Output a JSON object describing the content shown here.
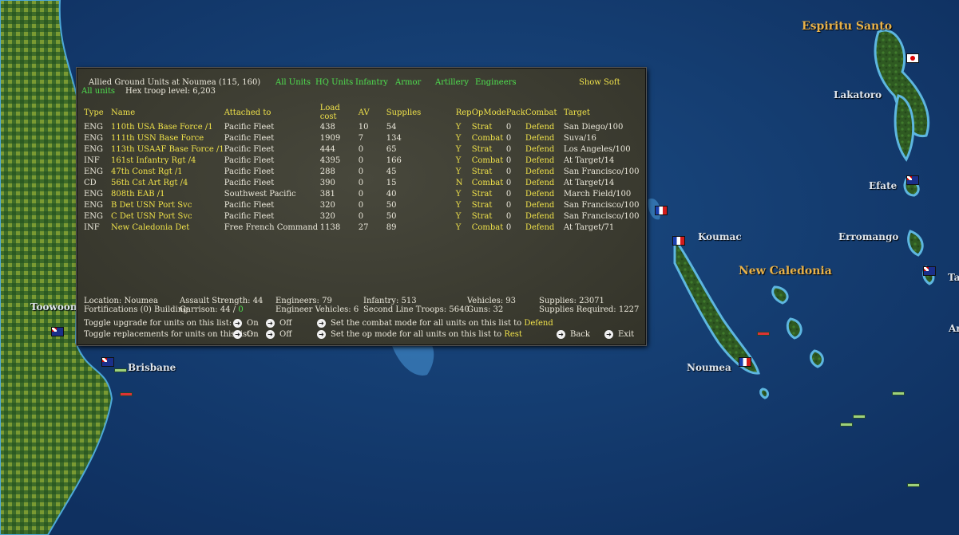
{
  "map": {
    "labels": [
      {
        "id": "espiritu-santo",
        "text": "Espiritu Santo",
        "cls": "region"
      },
      {
        "id": "lakatoro",
        "text": "Lakatoro",
        "cls": ""
      },
      {
        "id": "efate",
        "text": "Efate",
        "cls": ""
      },
      {
        "id": "erromango",
        "text": "Erromango",
        "cls": ""
      },
      {
        "id": "koumac",
        "text": "Koumac",
        "cls": ""
      },
      {
        "id": "new-caledonia",
        "text": "New Caledonia",
        "cls": "region"
      },
      {
        "id": "noumea",
        "text": "Noumea",
        "cls": ""
      },
      {
        "id": "toowoomba",
        "text": "Toowoomb",
        "cls": ""
      },
      {
        "id": "brisbane",
        "text": "Brisbane",
        "cls": ""
      },
      {
        "id": "ta",
        "text": "Ta",
        "cls": ""
      },
      {
        "id": "ar",
        "text": "Ar",
        "cls": ""
      }
    ]
  },
  "panel": {
    "title": "Allied Ground Units at Noumea  (115, 160)",
    "all_units_label": "All units",
    "hex_troop": "Hex troop level: 6,203",
    "filters": [
      "All Units",
      "HQ Units",
      "Infantry",
      "Armor",
      "Artillery",
      "Engineers"
    ],
    "show_soft": "Show Soft",
    "columns": [
      "Type",
      "Name",
      "Attached to",
      "Load cost",
      "AV",
      "Supplies",
      "Rep",
      "OpMode",
      "Pack",
      "Combat",
      "Target"
    ],
    "rows": [
      {
        "type": "ENG",
        "name": "110th USA Base Force /1",
        "attached": "Pacific Fleet",
        "load": "438",
        "av": "10",
        "sup": "54",
        "rep": "Y",
        "op": "Strat",
        "pack": "0",
        "combat": "Defend",
        "target": "San Diego/100"
      },
      {
        "type": "ENG",
        "name": "111th USN Base Force",
        "attached": "Pacific Fleet",
        "load": "1909",
        "av": "7",
        "sup": "134",
        "rep": "Y",
        "op": "Combat",
        "pack": "0",
        "combat": "Defend",
        "target": "Suva/16"
      },
      {
        "type": "ENG",
        "name": "113th USAAF Base Force /1",
        "attached": "Pacific Fleet",
        "load": "444",
        "av": "0",
        "sup": "65",
        "rep": "Y",
        "op": "Strat",
        "pack": "0",
        "combat": "Defend",
        "target": "Los Angeles/100"
      },
      {
        "type": "INF",
        "name": "161st Infantry Rgt /4",
        "attached": "Pacific Fleet",
        "load": "4395",
        "av": "0",
        "sup": "166",
        "rep": "Y",
        "op": "Combat",
        "pack": "0",
        "combat": "Defend",
        "target": "At Target/14"
      },
      {
        "type": "ENG",
        "name": "47th Const Rgt /1",
        "attached": "Pacific Fleet",
        "load": "288",
        "av": "0",
        "sup": "45",
        "rep": "Y",
        "op": "Strat",
        "pack": "0",
        "combat": "Defend",
        "target": "San Francisco/100"
      },
      {
        "type": "CD",
        "name": "56th Cst Art Rgt /4",
        "attached": "Pacific Fleet",
        "load": "390",
        "av": "0",
        "sup": "15",
        "rep": "N",
        "op": "Combat",
        "pack": "0",
        "combat": "Defend",
        "target": "At Target/14"
      },
      {
        "type": "ENG",
        "name": "808th EAB /1",
        "attached": "Southwest Pacific",
        "load": "381",
        "av": "0",
        "sup": "40",
        "rep": "Y",
        "op": "Strat",
        "pack": "0",
        "combat": "Defend",
        "target": "March Field/100"
      },
      {
        "type": "ENG",
        "name": "B Det USN Port Svc",
        "attached": "Pacific Fleet",
        "load": "320",
        "av": "0",
        "sup": "50",
        "rep": "Y",
        "op": "Strat",
        "pack": "0",
        "combat": "Defend",
        "target": "San Francisco/100"
      },
      {
        "type": "ENG",
        "name": "C Det USN Port Svc",
        "attached": "Pacific Fleet",
        "load": "320",
        "av": "0",
        "sup": "50",
        "rep": "Y",
        "op": "Strat",
        "pack": "0",
        "combat": "Defend",
        "target": "San Francisco/100"
      },
      {
        "type": "INF",
        "name": "New Caledonia Det",
        "attached": "Free French Command",
        "load": "1138",
        "av": "27",
        "sup": "89",
        "rep": "Y",
        "op": "Combat",
        "pack": "0",
        "combat": "Defend",
        "target": "At Target/71"
      }
    ],
    "summary": {
      "location": "Location: Noumea",
      "fortifications": "Fortifications (0) Building",
      "assault": "Assault Strength: 44",
      "garrison_label": "Garrison:  44 /",
      "garrison_value": "0",
      "engineers": "Engineers: 79",
      "eng_vehicles": "Engineer Vehicles:  6",
      "infantry": "Infantry: 513",
      "second_line": "Second Line Troops: 5640",
      "vehicles": "Vehicles: 93",
      "guns": "Guns: 32",
      "supplies": "Supplies:  23071",
      "supplies_req": "Supplies Required:  1227"
    },
    "controls": {
      "toggle_upgrade": "Toggle upgrade for units on this list:",
      "toggle_repl": "Toggle replacements for units on this list:",
      "on": "On",
      "off": "Off",
      "set_combat": "Set the combat mode for all units on this list to",
      "combat_value": "Defend",
      "set_op": "Set the op mode for all units on this list to",
      "op_value": "Rest",
      "back": "Back",
      "exit": "Exit"
    },
    "colors": {
      "accent_yellow": "#f0e24a",
      "accent_green": "#4fe04f"
    }
  }
}
